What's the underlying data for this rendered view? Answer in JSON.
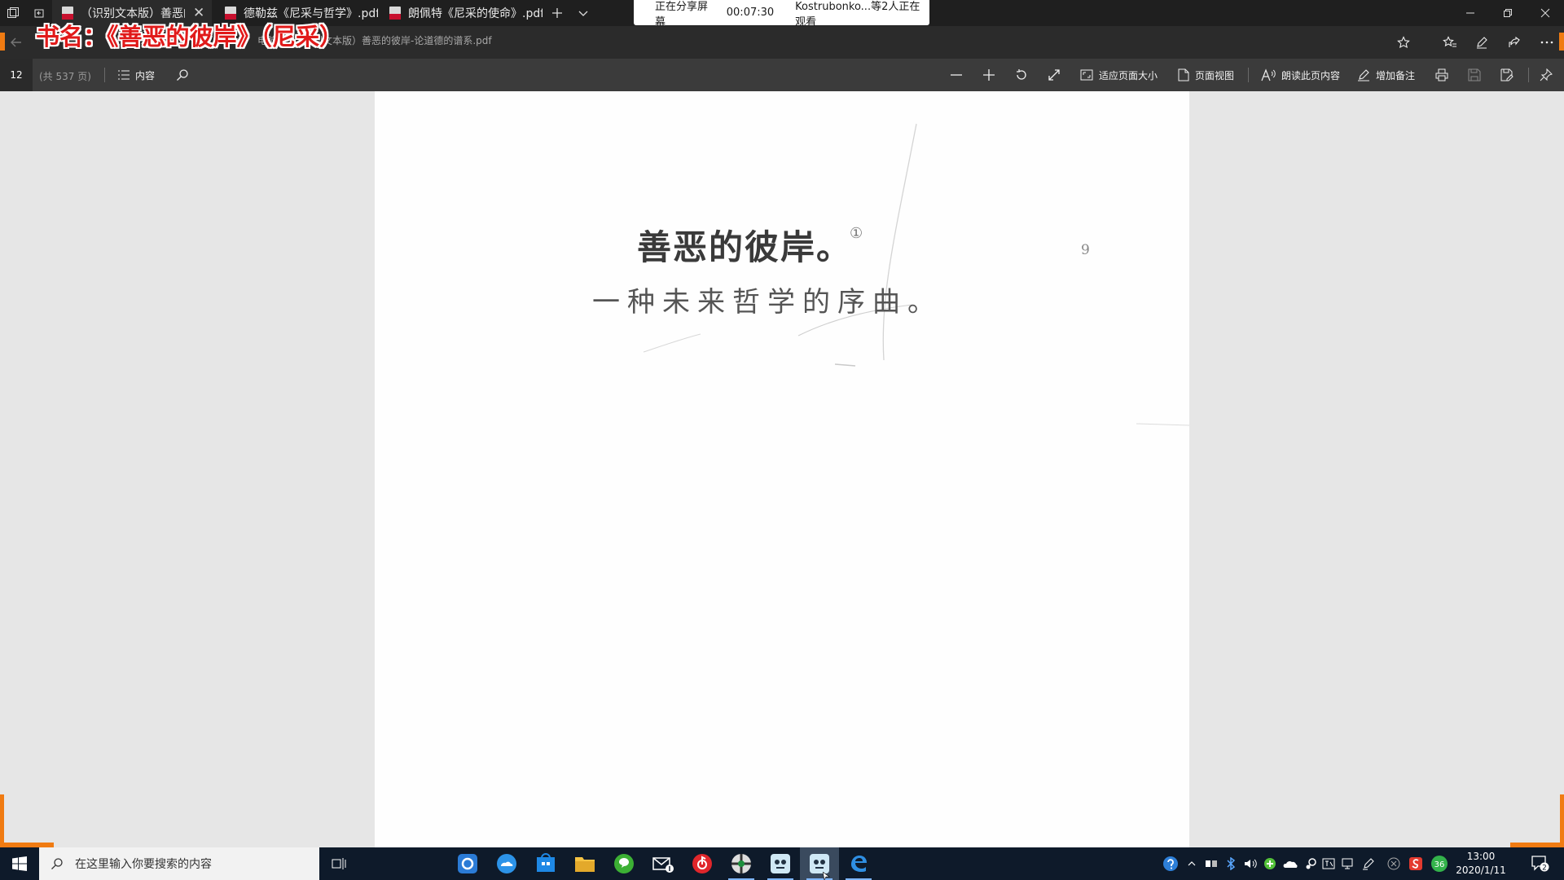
{
  "tabs": [
    {
      "label": "（识别文本版）善恶的彼岸",
      "active": true
    },
    {
      "label": "德勒兹《尼采与哲学》.pdf",
      "active": false
    },
    {
      "label": "朗佩特《尼采的使命》.pdf",
      "active": false
    }
  ],
  "share_bar": {
    "status": "正在分享屏幕",
    "timer": "00:07:30",
    "viewers": "Kostrubonko...等2人正在观看"
  },
  "overlay": {
    "title": "书名：《善恶的彼岸》（尼采）"
  },
  "address": {
    "path_fragment": "电脑",
    "url": "（识别文本版）善恶的彼岸-论道德的谱系.pdf"
  },
  "pdf_toolbar": {
    "page_current": "12",
    "page_total": "(共 537 页)",
    "contents_label": "内容",
    "fit_page_label": "适应页面大小",
    "page_view_label": "页面视图",
    "read_aloud_label": "朗读此页内容",
    "add_notes_label": "增加备注"
  },
  "document": {
    "title": "善恶的彼岸。",
    "footnote_mark": "①",
    "subtitle": "一种未来哲学的序曲。",
    "page_number": "9"
  },
  "taskbar": {
    "search_placeholder": "在这里输入你要搜索的内容",
    "time": "13:00",
    "date": "2020/1/11",
    "notification_count": "2",
    "badge_36": "36"
  },
  "colors": {
    "accent_orange": "#f07b12",
    "overlay_red": "#e11a1a",
    "pdf_red": "#c8102e"
  }
}
